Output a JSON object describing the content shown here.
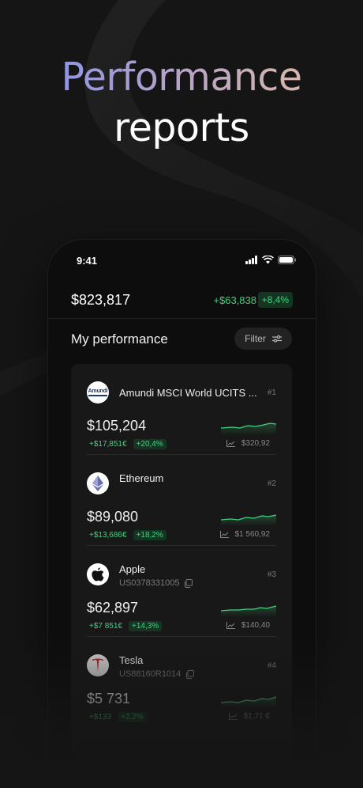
{
  "headline": {
    "line1": "Performance",
    "line2": "reports"
  },
  "status_bar": {
    "time": "9:41"
  },
  "portfolio": {
    "balance": "$823,817",
    "gain": "+$63,838",
    "gain_pct": "+8,4%"
  },
  "performance": {
    "title": "My performance",
    "filter_label": "Filter"
  },
  "assets": [
    {
      "name": "Amundi MSCI World UCITS ...",
      "rank": "#1",
      "value": "$105,204",
      "change_abs": "+$17,851€",
      "change_pct": "+20,4%",
      "price": "$320,92",
      "logo": "amundi-logo",
      "logo_text": "Amundi"
    },
    {
      "name": "Ethereum",
      "rank": "#2",
      "value": "$89,080",
      "change_abs": "+$13,686€",
      "change_pct": "+18,2%",
      "price": "$1 560,92",
      "logo": "ethereum-icon"
    },
    {
      "name": "Apple",
      "isin": "US0378331005",
      "rank": "#3",
      "value": "$62,897",
      "change_abs": "+$7 851€",
      "change_pct": "+14,3%",
      "price": "$140,40",
      "logo": "apple-icon"
    },
    {
      "name": "Tesla",
      "isin": "US88160R1014",
      "rank": "#4",
      "value": "$5 731",
      "change_abs": "+$133",
      "change_pct": "+2,2%",
      "price": "$1,71 €",
      "logo": "tesla-icon"
    }
  ],
  "colors": {
    "positive": "#43d17e",
    "background": "#151515"
  }
}
